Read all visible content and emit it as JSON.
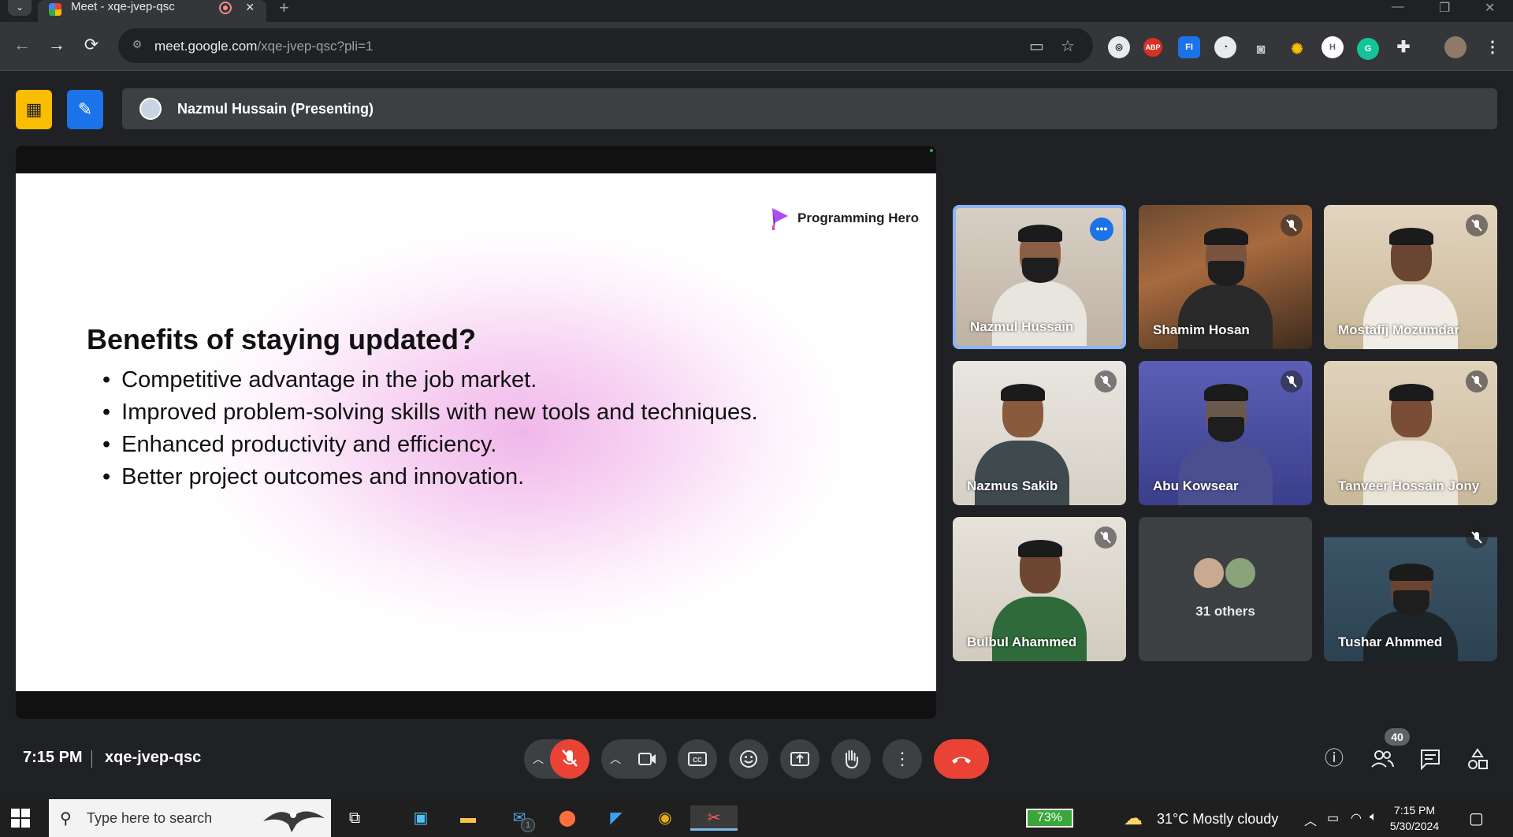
{
  "browser": {
    "tab_title": "Meet - xqe-jvep-qsc",
    "url_host": "meet.google.com",
    "url_path": "/xqe-jvep-qsc?pli=1"
  },
  "meet": {
    "presenter_label": "Nazmul Hussain (Presenting)",
    "time": "7:15 PM",
    "meeting_code": "xqe-jvep-qsc",
    "people_count": "40"
  },
  "slide": {
    "brand": "Programming Hero",
    "title": "Benefits of staying updated?",
    "bullets": [
      "Competitive advantage in the job market.",
      "Improved problem-solving skills with new tools and techniques.",
      "Enhanced productivity and efficiency.",
      "Better project outcomes and innovation."
    ]
  },
  "participants": [
    {
      "name": "Nazmul Hussain"
    },
    {
      "name": "Shamim Hosan"
    },
    {
      "name": "Mostafij Mozumdar"
    },
    {
      "name": "Nazmus Sakib"
    },
    {
      "name": "Abu Kowsear"
    },
    {
      "name": "Tanveer Hossain Jony"
    },
    {
      "name": "Bulbul Ahammed"
    },
    {
      "name": "31 others"
    },
    {
      "name": "Tushar Ahmmed"
    }
  ],
  "taskbar": {
    "search_placeholder": "Type here to search",
    "battery": "73%",
    "weather": "31°C  Mostly cloudy",
    "clock_time": "7:15 PM",
    "clock_date": "5/30/2024",
    "mail_badge": "1"
  },
  "colors": {
    "accent_blue": "#8ab4f8",
    "hangup_red": "#ea4335",
    "active_tile_border": "#8ab4f8"
  }
}
